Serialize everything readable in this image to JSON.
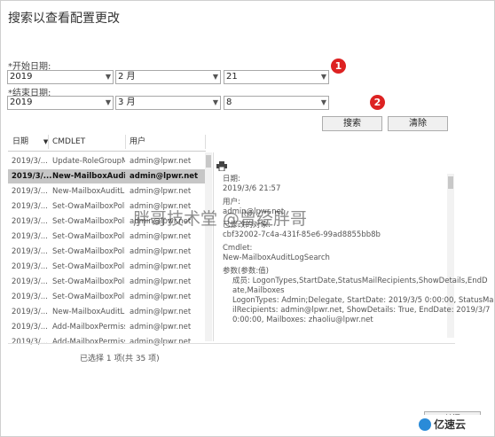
{
  "title": "搜索以查看配置更改",
  "start": {
    "label": "*开始日期:",
    "year": "2019",
    "month": "2 月",
    "day": "21"
  },
  "end": {
    "label": "*结束日期:",
    "year": "2019",
    "month": "3 月",
    "day": "8"
  },
  "badges": [
    "1",
    "2"
  ],
  "buttons": {
    "search": "搜索",
    "clear": "清除",
    "close": "关闭"
  },
  "columns": {
    "date": "日期",
    "cmdlet": "CMDLET",
    "user": "用户"
  },
  "rows": [
    {
      "date": "2019/3/...",
      "cmdlet": "Update-RoleGroupM...",
      "user": "admin@lpwr.net"
    },
    {
      "date": "2019/3/...",
      "cmdlet": "New-MailboxAuditL...",
      "user": "admin@lpwr.net"
    },
    {
      "date": "2019/3/...",
      "cmdlet": "New-MailboxAuditL...",
      "user": "admin@lpwr.net"
    },
    {
      "date": "2019/3/...",
      "cmdlet": "Set-OwaMailboxPolicy",
      "user": "admin@lpwr.net"
    },
    {
      "date": "2019/3/...",
      "cmdlet": "Set-OwaMailboxPolicy",
      "user": "admin@lpwr.net"
    },
    {
      "date": "2019/3/...",
      "cmdlet": "Set-OwaMailboxPolicy",
      "user": "admin@lpwr.net"
    },
    {
      "date": "2019/3/...",
      "cmdlet": "Set-OwaMailboxPolicy",
      "user": "admin@lpwr.net"
    },
    {
      "date": "2019/3/...",
      "cmdlet": "Set-OwaMailboxPolicy",
      "user": "admin@lpwr.net"
    },
    {
      "date": "2019/3/...",
      "cmdlet": "Set-OwaMailboxPolicy",
      "user": "admin@lpwr.net"
    },
    {
      "date": "2019/3/...",
      "cmdlet": "Set-OwaMailboxPolicy",
      "user": "admin@lpwr.net"
    },
    {
      "date": "2019/3/...",
      "cmdlet": "New-MailboxAuditL...",
      "user": "admin@lpwr.net"
    },
    {
      "date": "2019/3/...",
      "cmdlet": "Add-MailboxPermiss...",
      "user": "admin@lpwr.net"
    },
    {
      "date": "2019/3/...",
      "cmdlet": "Add-MailboxPermiss...",
      "user": "admin@lpwr.net"
    }
  ],
  "detail": {
    "date_label": "日期:",
    "date_value": "2019/3/6 21:57",
    "user_label": "用户:",
    "user_value": "admin@lpwr.net",
    "object_label": "已修改的对象:",
    "object_value": "cbf32002-7c4a-431f-85e6-99ad8855bb8b",
    "cmdlet_label": "Cmdlet:",
    "cmdlet_value": "New-MailboxAuditLogSearch",
    "params_label": "参数(参数:值)",
    "p1a": "成员: LogonTypes,StartDate,StatusMailRecipients,ShowDetails,EndD",
    "p1b": "ate,Mailboxes",
    "p2a": "LogonTypes: Admin;Delegate, StartDate: 2019/3/5 0:00:00, StatusMa",
    "p2b": "ilRecipients: admin@lpwr.net, ShowDetails: True, EndDate: 2019/3/7",
    "p2c": "0:00:00, Mailboxes: zhaoliu@lpwr.net"
  },
  "watermark": "胖哥技术堂 @曾经胖哥",
  "status": "已选择 1 项(共 35 项)",
  "logo_text": "亿速云"
}
